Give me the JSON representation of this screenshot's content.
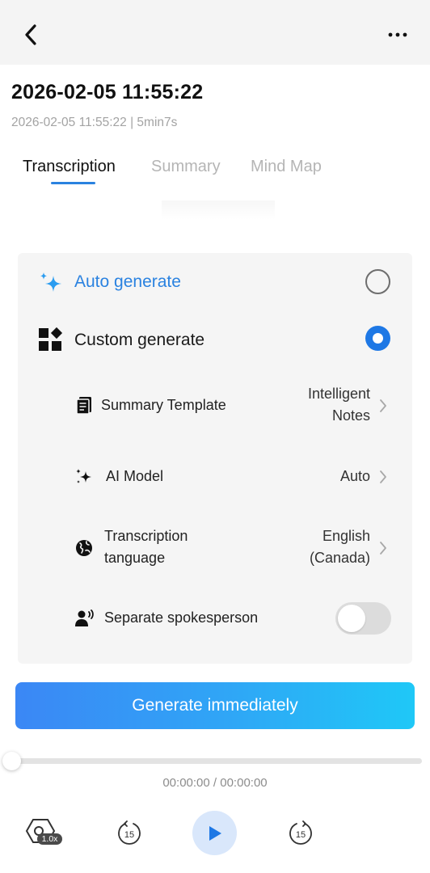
{
  "header": {
    "back_icon": "chevron-left-icon",
    "more_icon": "ellipsis-icon"
  },
  "recording": {
    "title": "2026-02-05 11:55:22",
    "meta": "2026-02-05 11:55:22 | 5min7s"
  },
  "tabs": [
    {
      "label": "Transcription",
      "active": true
    },
    {
      "label": "Summary",
      "active": false
    },
    {
      "label": "Mind Map",
      "active": false
    }
  ],
  "options": {
    "auto": {
      "label": "Auto generate",
      "selected": false,
      "icon": "sparkle-icon",
      "color": "#2a82e0"
    },
    "custom": {
      "label": "Custom generate",
      "selected": true,
      "icon": "widgets-icon"
    }
  },
  "settings": {
    "template": {
      "label": "Summary Template",
      "value_line1": "Intelligent",
      "value_line2": "Notes",
      "icon": "document-icon"
    },
    "model": {
      "label": "AI Model",
      "value": "Auto",
      "icon": "sparkle-icon"
    },
    "language": {
      "label_line1": "Transcription",
      "label_line2": "tanguage",
      "value_line1": "English",
      "value_line2": "(Canada)",
      "icon": "globe-icon"
    },
    "speaker": {
      "label": "Separate spokesperson",
      "enabled": false,
      "icon": "speaker-person-icon"
    }
  },
  "generate_button": {
    "label": "Generate immediately"
  },
  "player": {
    "current_time": "00:00:00",
    "separator": "/",
    "total_time": "00:00:00",
    "progress": 0,
    "speed": "1.0x",
    "rewind_label": "15",
    "forward_label": "15"
  },
  "colors": {
    "accent": "#1e78e5",
    "button_gradient_start": "#3b87f5",
    "button_gradient_end": "#1fc8f7"
  }
}
